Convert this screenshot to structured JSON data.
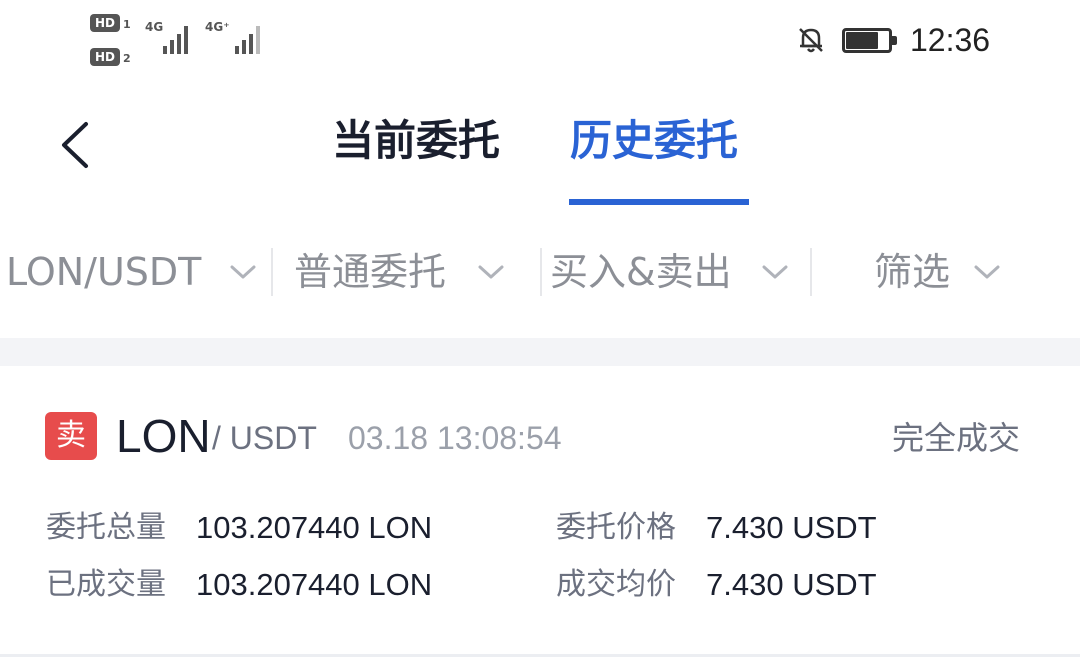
{
  "status_bar": {
    "sim1_label": "HD",
    "sim1_num": "1",
    "sim2_label": "HD",
    "sim2_num": "2",
    "net1": "4G",
    "net2": "4G⁺",
    "time": "12:36",
    "icons": [
      "signal-icon",
      "bell-off-icon",
      "battery-icon"
    ]
  },
  "header": {
    "tabs": [
      {
        "label": "当前委托",
        "active": false
      },
      {
        "label": "历史委托",
        "active": true
      }
    ],
    "accent_color": "#2a63d4"
  },
  "filters": [
    {
      "label": "LON/USDT"
    },
    {
      "label": "普通委托"
    },
    {
      "label": "买入&卖出"
    },
    {
      "label": "筛选"
    }
  ],
  "order": {
    "side": "卖",
    "side_color": "#e74c4c",
    "base": "LON",
    "quote": "/ USDT",
    "time": "03.18 13:08:54",
    "status": "完全成交",
    "fields": {
      "total_amount_label": "委托总量",
      "total_amount_value": "103.207440 LON",
      "price_label": "委托价格",
      "price_value": "7.430 USDT",
      "filled_amount_label": "已成交量",
      "filled_amount_value": "103.207440 LON",
      "avg_price_label": "成交均价",
      "avg_price_value": "7.430 USDT"
    }
  }
}
